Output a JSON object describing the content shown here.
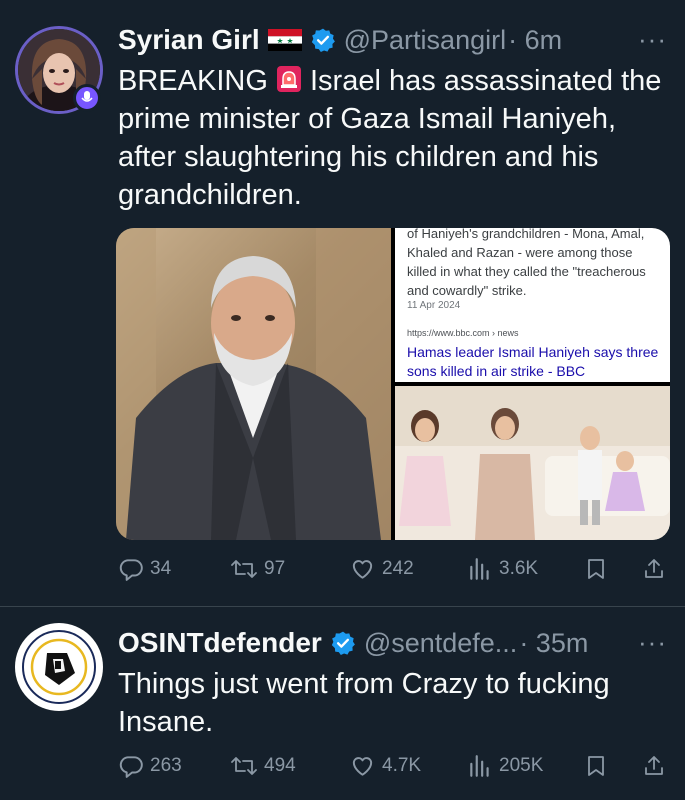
{
  "tweets": [
    {
      "name": "Syrian Girl",
      "handle": "@Partisangirl",
      "time": "· 6m",
      "text_lead": "BREAKING",
      "text_rest": " Israel has assassinated the prime minister of Gaza Ismail Haniyeh, after slaughtering his children and his grandchildren.",
      "media": {
        "snippet_body": "of Haniyeh's grandchildren - Mona, Amal, Khaled and Razan - were among those killed in what they called the \"treacherous and cowardly\" strike.",
        "snippet_date": "11 Apr 2024",
        "snippet_url": "https://www.bbc.com › news",
        "snippet_link": "Hamas leader Ismail Haniyeh says three sons killed in air strike - BBC"
      },
      "stats": {
        "replies": "34",
        "reposts": "97",
        "likes": "242",
        "views": "3.6K"
      }
    },
    {
      "name": "OSINTdefender",
      "handle": "@sentdefe...",
      "time": "· 35m",
      "text": "Things just went from Crazy to fucking Insane.",
      "stats": {
        "replies": "263",
        "reposts": "494",
        "likes": "4.7K",
        "views": "205K"
      }
    }
  ],
  "more_label": "···",
  "colors": {
    "background": "#15202b",
    "text": "#f7f9f9",
    "muted": "#8b98a5",
    "verified": "#1d9bf0",
    "separator": "#38444d"
  },
  "icons": [
    "reply-icon",
    "repost-icon",
    "like-icon",
    "views-icon",
    "bookmark-icon",
    "share-icon",
    "verified-icon",
    "flag-icon",
    "siren-icon"
  ]
}
